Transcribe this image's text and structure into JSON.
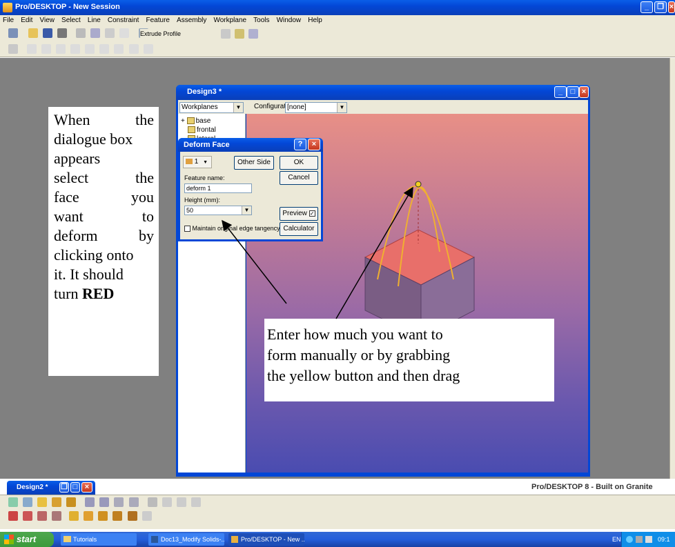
{
  "app": {
    "title": "Pro/DESKTOP - New Session",
    "menu": [
      "File",
      "Edit",
      "View",
      "Select",
      "Line",
      "Constraint",
      "Feature",
      "Assembly",
      "Workplane",
      "Tools",
      "Window",
      "Help"
    ],
    "toolbar_field": "Extrude Profile",
    "status_brand": "Pro/DESKTOP 8 - Built on Granite"
  },
  "design_window": {
    "title": "Design3 *",
    "workplanes_combo": "Workplanes",
    "configuration_label": "Configuration:",
    "configuration_value": "[none]",
    "tree": [
      "base",
      "frontal",
      "lateral"
    ]
  },
  "dialog": {
    "title": "Deform Face",
    "face_selector": "1",
    "other_side": "Other Side",
    "ok": "OK",
    "cancel": "Cancel",
    "feature_name_label": "Feature name:",
    "feature_name_value": "deform 1",
    "height_label": "Height (mm):",
    "height_value": "50",
    "preview_label": "Preview",
    "preview_checked": true,
    "tangency_label": "Maintain original edge tangency",
    "tangency_checked": false,
    "calculator": "Calculator"
  },
  "minimized_window": {
    "title": "Design2 *"
  },
  "annotations": {
    "left_note_words": [
      "When",
      "the",
      "dialogue box",
      "appears",
      "select",
      "the",
      "face",
      "you",
      "want",
      "to",
      "deform",
      "by",
      "clicking onto",
      "it. It should",
      "turn"
    ],
    "left_note_red": "RED",
    "right_note": [
      "Enter how much you want to",
      "form manually or by grabbing",
      "the yellow button and then drag"
    ]
  },
  "taskbar": {
    "start": "start",
    "items": [
      "Tutorials",
      "Doc13_Modify Solids-...",
      "Pro/DESKTOP - New ..."
    ],
    "lang": "EN",
    "clock": "09:1"
  },
  "colors": {
    "xp_blue": "#0347d6",
    "workspace": "#808080",
    "selected_face": "#e05a5a",
    "drag_handle": "#f0c020"
  }
}
